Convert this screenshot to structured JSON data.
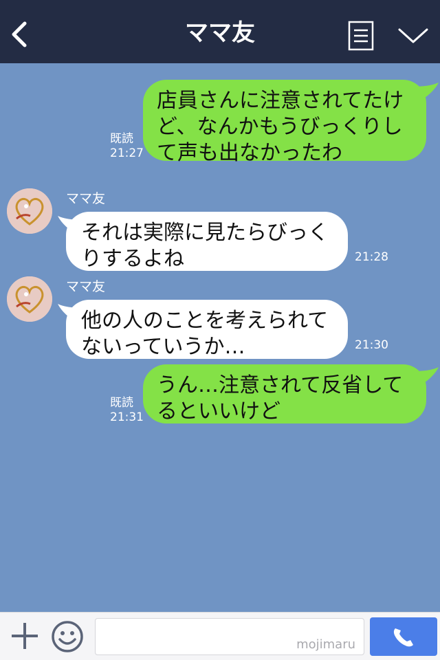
{
  "header": {
    "title": "ママ友"
  },
  "messages": [
    {
      "direction": "out",
      "text": "店員さんに注意されてたけ\nど、なんかもうびっくりし\nて声も出なかったわ",
      "read": "既読",
      "time": "21:27"
    },
    {
      "direction": "in",
      "sender": "ママ友",
      "text": "それは実際に見たらびっく\nりするよね",
      "time": "21:28"
    },
    {
      "direction": "in",
      "sender": "ママ友",
      "text": "他の人のことを考えられて\nないっていうか…",
      "time": "21:30"
    },
    {
      "direction": "out",
      "text": "うん…注意されて反省して\nるといいけど",
      "read": "既読",
      "time": "21:31"
    }
  ],
  "input": {
    "watermark": "mojimaru"
  },
  "icons": {
    "back": "chevron-left-icon",
    "menu": "list-menu-icon",
    "collapse": "chevron-down-icon",
    "add": "plus-icon",
    "emoji": "smiley-icon",
    "call": "phone-icon"
  },
  "colors": {
    "header": "#232c44",
    "background": "#7094c4",
    "outgoing_bubble": "#84e147",
    "incoming_bubble": "#ffffff",
    "call_button": "#4b7ee8"
  }
}
